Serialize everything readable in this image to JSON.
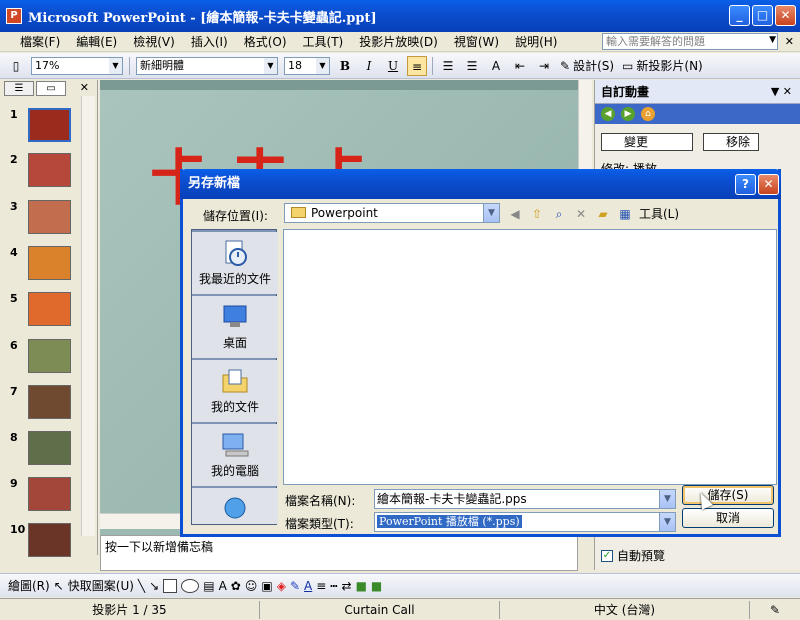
{
  "window": {
    "title": "Microsoft PowerPoint - [繪本簡報-卡夫卡變蟲記.ppt]",
    "minimize": "_",
    "maximize": "□",
    "close": "✕"
  },
  "menu": {
    "items": [
      "檔案(F)",
      "編輯(E)",
      "檢視(V)",
      "插入(I)",
      "格式(O)",
      "工具(T)",
      "投影片放映(D)",
      "視窗(W)",
      "說明(H)"
    ],
    "help_placeholder": "輸入需要解答的問題"
  },
  "toolbar": {
    "zoom": "17%",
    "font": "新細明體",
    "size": "18",
    "bold": "B",
    "italic": "I",
    "underline": "U",
    "design": "設計(S)",
    "new_slide": "新投影片(N)"
  },
  "slides_panel": {
    "numbers": [
      "1",
      "2",
      "3",
      "4",
      "5",
      "6",
      "7",
      "8",
      "9",
      "10"
    ]
  },
  "main": {
    "book_title": "卡夫卡",
    "notes_text": "按一下以新增備忘稿"
  },
  "taskpane": {
    "title": "自訂動畫",
    "change_button": "變更",
    "remove_button": "移除",
    "modify_label": "修改: 播放",
    "auto_preview": "自動預覽"
  },
  "drawbar": {
    "draw_label": "繪圖(R)",
    "autoshapes_label": "快取圖案(U)"
  },
  "status": {
    "slide_info": "投影片 1 / 35",
    "design_name": "Curtain Call",
    "language": "中文 (台灣)"
  },
  "dialog": {
    "title": "另存新檔",
    "help": "?",
    "close": "✕",
    "save_in_label": "儲存位置(I):",
    "save_in_value": "Powerpoint",
    "tools_label": "工具(L)",
    "places": [
      "我最近的文件",
      "桌面",
      "我的文件",
      "我的電腦"
    ],
    "filename_label": "檔案名稱(N):",
    "filename_value": "繪本簡報-卡夫卡變蟲記.pps",
    "filetype_label": "檔案類型(T):",
    "filetype_value": "PowerPoint 播放檔 (*.pps)",
    "save_button": "儲存(S)",
    "cancel_button": "取消"
  }
}
